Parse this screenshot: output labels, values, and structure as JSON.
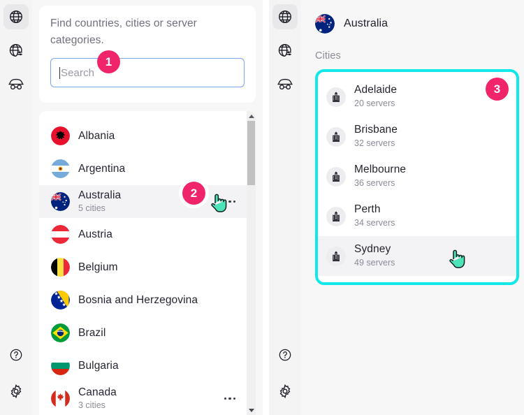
{
  "app": {
    "accent_pink": "#f0246b",
    "accent_teal": "#12e8e8",
    "cursor_color": "#4de3b8"
  },
  "left_window": {
    "rail": {
      "items": [
        {
          "icon": "globe-icon",
          "name": "servers",
          "active": true
        },
        {
          "icon": "globe-settings-icon",
          "name": "connection-settings",
          "active": false
        },
        {
          "icon": "incognito-icon",
          "name": "private-mode",
          "active": false
        }
      ],
      "bottom_items": [
        {
          "icon": "help-icon",
          "name": "help"
        },
        {
          "icon": "gear-icon",
          "name": "settings"
        }
      ]
    },
    "search": {
      "prompt": "Find countries, cities or server categories.",
      "placeholder": "Search",
      "value": ""
    },
    "countries": [
      {
        "name": "Albania",
        "sub": "",
        "flag": "albania",
        "selected": false,
        "menu": false
      },
      {
        "name": "Argentina",
        "sub": "",
        "flag": "argentina",
        "selected": false,
        "menu": false
      },
      {
        "name": "Australia",
        "sub": "5 cities",
        "flag": "australia",
        "selected": true,
        "menu": true
      },
      {
        "name": "Austria",
        "sub": "",
        "flag": "austria",
        "selected": false,
        "menu": false
      },
      {
        "name": "Belgium",
        "sub": "",
        "flag": "belgium",
        "selected": false,
        "menu": false
      },
      {
        "name": "Bosnia and Herzegovina",
        "sub": "",
        "flag": "bosnia",
        "selected": false,
        "menu": false
      },
      {
        "name": "Brazil",
        "sub": "",
        "flag": "brazil",
        "selected": false,
        "menu": false
      },
      {
        "name": "Bulgaria",
        "sub": "",
        "flag": "bulgaria",
        "selected": false,
        "menu": false
      },
      {
        "name": "Canada",
        "sub": "3 cities",
        "flag": "canada",
        "selected": false,
        "menu": true
      }
    ],
    "scrollbar": {
      "up_arrow": "▲",
      "down_arrow": "▼"
    }
  },
  "right_window": {
    "rail": {
      "items": [
        {
          "icon": "globe-icon",
          "name": "servers",
          "active": true
        },
        {
          "icon": "globe-settings-icon",
          "name": "connection-settings",
          "active": false
        },
        {
          "icon": "incognito-icon",
          "name": "private-mode",
          "active": false
        }
      ],
      "bottom_items": [
        {
          "icon": "help-icon",
          "name": "help"
        },
        {
          "icon": "gear-icon",
          "name": "settings"
        }
      ]
    },
    "header": {
      "country": "Australia",
      "flag": "australia"
    },
    "section_label": "Cities",
    "cities": [
      {
        "name": "Adelaide",
        "servers": "20 servers",
        "hovered": false
      },
      {
        "name": "Brisbane",
        "servers": "32 servers",
        "hovered": false
      },
      {
        "name": "Melbourne",
        "servers": "36 servers",
        "hovered": false
      },
      {
        "name": "Perth",
        "servers": "34 servers",
        "hovered": false
      },
      {
        "name": "Sydney",
        "servers": "49 servers",
        "hovered": true
      }
    ]
  },
  "annotations": {
    "badge_1": "1",
    "badge_2": "2",
    "badge_3": "3"
  }
}
